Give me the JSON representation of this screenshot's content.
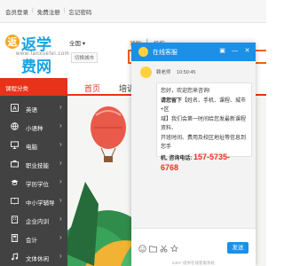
{
  "topbar": {
    "links": [
      "会员登录",
      "免费注册",
      "忘记密码"
    ]
  },
  "header": {
    "logo_text": "返学费网",
    "site_url": "www.fanxuefei.com",
    "city": "全国",
    "city_switch": "切换城市",
    "search_tabs": [
      "课程",
      "机构"
    ]
  },
  "nav": {
    "category_label": "课程分类",
    "items": [
      "首页",
      "培训课程"
    ]
  },
  "sidebar": {
    "items": [
      {
        "label": "英语",
        "icon": "letter-icon"
      },
      {
        "label": "小语种",
        "icon": "globe-icon"
      },
      {
        "label": "电脑",
        "icon": "monitor-icon"
      },
      {
        "label": "职业技能",
        "icon": "briefcase-icon"
      },
      {
        "label": "学历学位",
        "icon": "graduation-cap-icon"
      },
      {
        "label": "中小学辅导",
        "icon": "book-icon"
      },
      {
        "label": "企业内训",
        "icon": "building-icon"
      },
      {
        "label": "会计",
        "icon": "calculator-icon"
      },
      {
        "label": "文体休闲",
        "icon": "music-icon"
      }
    ]
  },
  "chat": {
    "title": "在线客服",
    "agent": "赖老师",
    "time": "10:50:45",
    "message_lines": [
      "您好，欢迎您来咨询!",
      "【姓名、手机、课程、城市+区"
    ],
    "leave_label": "请您留下",
    "message_rest": [
      "域】我们会第一时间给您发最新课程资料、",
      "开班时间、费用及校区地址等信息到您手",
      "机, 咨询电话:"
    ],
    "phone": "157-5735-6768",
    "send_label": "发送",
    "powered_by": "53KF 提供在线客服系统"
  },
  "colors": {
    "brand_red": "#e7331a",
    "brand_orange": "#f06400",
    "chat_blue": "#1c8fe6",
    "sidebar_bg": "#424242"
  }
}
